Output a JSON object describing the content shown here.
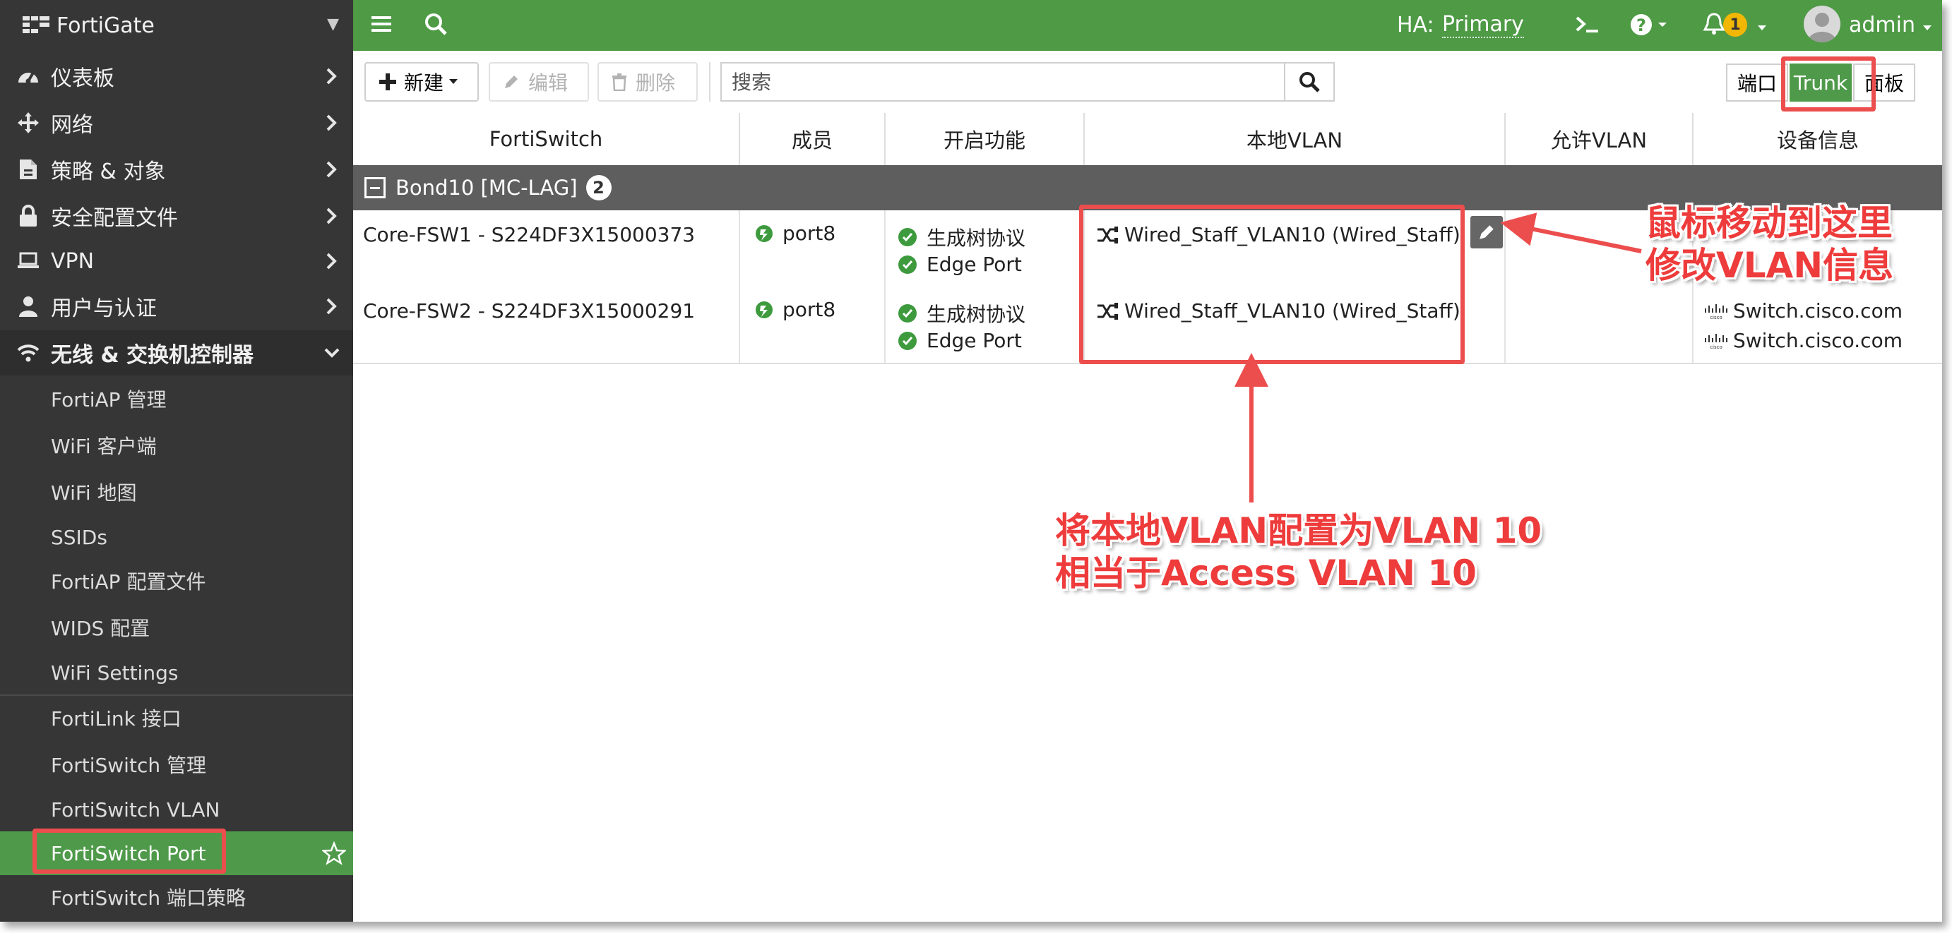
{
  "brand": {
    "name": "FortiGate"
  },
  "sidebar": {
    "items": [
      {
        "label": "仪表板",
        "icon": "dashboard-icon"
      },
      {
        "label": "网络",
        "icon": "network-move-icon"
      },
      {
        "label": "策略 & 对象",
        "icon": "policy-icon"
      },
      {
        "label": "安全配置文件",
        "icon": "lock-icon"
      },
      {
        "label": "VPN",
        "icon": "laptop-icon"
      },
      {
        "label": "用户与认证",
        "icon": "user-icon"
      },
      {
        "label": "无线 & 交换机控制器",
        "icon": "wifi-icon"
      }
    ],
    "subitems": [
      "FortiAP 管理",
      "WiFi 客户端",
      "WiFi 地图",
      "SSIDs",
      "FortiAP 配置文件",
      "WIDS 配置",
      "WiFi Settings",
      "FortiLink 接口",
      "FortiSwitch 管理",
      "FortiSwitch VLAN",
      "FortiSwitch Port",
      "FortiSwitch 端口策略"
    ]
  },
  "topbar": {
    "ha_label": "HA:",
    "ha_value": "Primary",
    "notification_count": "1",
    "user": "admin"
  },
  "toolbar": {
    "new_label": "新建",
    "edit_label": "编辑",
    "delete_label": "删除",
    "search_placeholder": "搜索",
    "view_port": "端口",
    "view_trunk": "Trunk",
    "view_panel": "面板"
  },
  "table": {
    "headers": [
      "FortiSwitch",
      "成员",
      "开启功能",
      "本地VLAN",
      "允许VLAN",
      "设备信息"
    ],
    "group": {
      "name": "Bond10 [MC-LAG]",
      "count": "2"
    },
    "rows": [
      {
        "switch": "Core-FSW1 - S224DF3X15000373",
        "member": "port8",
        "features": [
          "生成树协议",
          "Edge Port"
        ],
        "native_vlan": "Wired_Staff_VLAN10 (Wired_Staff)",
        "allowed_vlan": "",
        "device_info": []
      },
      {
        "switch": "Core-FSW2 - S224DF3X15000291",
        "member": "port8",
        "features": [
          "生成树协议",
          "Edge Port"
        ],
        "native_vlan": "Wired_Staff_VLAN10 (Wired_Staff)",
        "allowed_vlan": "",
        "device_info": [
          "Switch.cisco.com",
          "Switch.cisco.com"
        ]
      }
    ]
  },
  "annotations": {
    "edit_hint_line1": "鼠标移动到这里",
    "edit_hint_line2": "修改VLAN信息",
    "vlan_hint_line1": "将本地VLAN配置为VLAN 10",
    "vlan_hint_line2": "相当于Access VLAN 10"
  },
  "colors": {
    "accent_green": "#4e9a45",
    "sidebar_bg": "#363636",
    "annotation_red": "#ec4e4e",
    "badge_yellow": "#f2b705"
  }
}
